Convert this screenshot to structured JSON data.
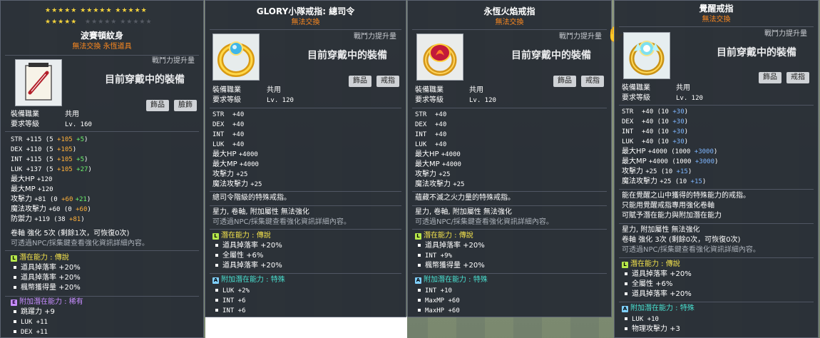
{
  "panel1": {
    "stars_row1": "★★★★★ ★★★★★ ★★★★★",
    "stars_row2_gold": "★★★★★",
    "stars_row2_gray": "★★★★★ ★★★★★",
    "title": "波賽頓紋身",
    "subtitle": "無法交換  永恆道具",
    "power_label": "戰鬥力提升量",
    "equipped": "目前穿戴中的裝備",
    "tags": [
      "飾品",
      "臉飾"
    ],
    "job_label": "裝備職業",
    "job_value": "共用",
    "level_label": "要求等級",
    "level_value": "Lv. 160",
    "stats": [
      {
        "label": "STR",
        "base": "+115 (5 ",
        "add1": "+105",
        "add2": "+5",
        "close": ")"
      },
      {
        "label": "DEX",
        "base": "+110 (5 ",
        "add1": "+105",
        "add2": "",
        "close": ")"
      },
      {
        "label": "INT",
        "base": "+115 (5 ",
        "add1": "+105",
        "add2": "+5",
        "close": ")"
      },
      {
        "label": "LUK",
        "base": "+137 (5 ",
        "add1": "+105",
        "add2": "+27",
        "close": ")"
      },
      {
        "label": "最大HP",
        "base": "+120",
        "add1": "",
        "add2": "",
        "close": ""
      },
      {
        "label": "最大MP",
        "base": "+120",
        "add1": "",
        "add2": "",
        "close": ""
      },
      {
        "label": "攻擊力",
        "base": "+81 (0 ",
        "add1": "+60",
        "add2": "+21",
        "close": ")"
      },
      {
        "label": "魔法攻擊力",
        "base": "+60 (0 ",
        "add1": "+60",
        "add2": "",
        "close": ")"
      },
      {
        "label": "防禦力",
        "base": "+119 (38 ",
        "add1": "+81",
        "add2": "",
        "close": ")"
      }
    ],
    "scroll_line": "卷軸 強化 5次 (剩餘1次，可恢復0次)",
    "npc_line": "可透過NPC/採集鍵查看強化資訊詳細內容。",
    "potential_label": "潛在能力 : 傳說",
    "potential": [
      "道具掉落率 +20%",
      "道具掉落率 +20%",
      "楓幣獲得量 +20%"
    ],
    "add_potential_label": "附加潛在能力 : 稀有",
    "add_potential": [
      "跳躍力 +9",
      "LUK +11",
      "DEX +11"
    ]
  },
  "panel2": {
    "title": "GLORY小隊戒指: 總司令",
    "subtitle": "無法交換",
    "power_label": "戰鬥力提升量",
    "equipped": "目前穿戴中的裝備",
    "tags": [
      "飾品",
      "戒指"
    ],
    "job_label": "裝備職業",
    "job_value": "共用",
    "level_label": "要求等級",
    "level_value": "Lv. 120",
    "stats": [
      {
        "label": "STR",
        "value": "+40"
      },
      {
        "label": "DEX",
        "value": "+40"
      },
      {
        "label": "INT",
        "value": "+40"
      },
      {
        "label": "LUK",
        "value": "+40"
      },
      {
        "label": "最大HP",
        "value": "+4000"
      },
      {
        "label": "最大MP",
        "value": "+4000"
      },
      {
        "label": "攻擊力",
        "value": "+25"
      },
      {
        "label": "魔法攻擊力",
        "value": "+25"
      }
    ],
    "desc": "總司令階級的特殊戒指。",
    "flags": "星力, 卷軸, 附加屬性 無法強化",
    "npc_line": "可透過NPC/採集鍵查看強化資訊詳細內容。",
    "potential_label": "潛在能力 : 傳說",
    "potential": [
      "道具掉落率 +20%",
      "全屬性 +6%",
      "道具掉落率 +20%"
    ],
    "add_potential_label": "附加潛在能力 : 特殊",
    "add_potential": [
      "LUK +2%",
      "INT +6",
      "INT +6"
    ]
  },
  "panel3": {
    "title": "永恆火焰戒指",
    "subtitle": "無法交換",
    "power_label": "戰鬥力提升量",
    "equipped": "目前穿戴中的裝備",
    "tags": [
      "飾品",
      "戒指"
    ],
    "job_label": "裝備職業",
    "job_value": "共用",
    "level_label": "要求等級",
    "level_value": "Lv. 120",
    "stats": [
      {
        "label": "STR",
        "value": "+40"
      },
      {
        "label": "DEX",
        "value": "+40"
      },
      {
        "label": "INT",
        "value": "+40"
      },
      {
        "label": "LUK",
        "value": "+40"
      },
      {
        "label": "最大HP",
        "value": "+4000"
      },
      {
        "label": "最大MP",
        "value": "+4000"
      },
      {
        "label": "攻擊力",
        "value": "+25"
      },
      {
        "label": "魔法攻擊力",
        "value": "+25"
      }
    ],
    "desc": "蘊藏不滅之火力量的特殊戒指。",
    "flags": "星力, 卷軸, 附加屬性 無法強化",
    "npc_line": "可透過NPC/採集鍵查看強化資訊詳細內容。",
    "potential_label": "潛在能力 : 傳說",
    "potential": [
      "道具掉落率 +20%",
      "INT +9%",
      "楓幣獲得量 +20%"
    ],
    "add_potential_label": "附加潛在能力 : 特殊",
    "add_potential": [
      "INT +10",
      "MaxMP +60",
      "MaxHP +60"
    ]
  },
  "panel4": {
    "title": "覺醒戒指",
    "subtitle": "無法交換",
    "power_label": "戰鬥力提升量",
    "equipped": "目前穿戴中的裝備",
    "tags": [
      "飾品",
      "戒指"
    ],
    "job_label": "裝備職業",
    "job_value": "共用",
    "level_label": "要求等級",
    "level_value": "Lv. 120",
    "stats": [
      {
        "label": "STR",
        "base": "+40 (10 ",
        "add": "+30",
        "close": ")"
      },
      {
        "label": "DEX",
        "base": "+40 (10 ",
        "add": "+30",
        "close": ")"
      },
      {
        "label": "INT",
        "base": "+40 (10 ",
        "add": "+30",
        "close": ")"
      },
      {
        "label": "LUK",
        "base": "+40 (10 ",
        "add": "+30",
        "close": ")"
      },
      {
        "label": "最大HP",
        "base": "+4000 (1000 ",
        "add": "+3000",
        "close": ")"
      },
      {
        "label": "最大MP",
        "base": "+4000 (1000 ",
        "add": "+3000",
        "close": ")"
      },
      {
        "label": "攻擊力",
        "base": "+25 (10 ",
        "add": "+15",
        "close": ")"
      },
      {
        "label": "魔法攻擊力",
        "base": "+25 (10 ",
        "add": "+15",
        "close": ")"
      }
    ],
    "desc": [
      "能在覺醒之山中獲得的特殊能力的戒指。",
      "只能用覺醒戒指專用強化卷軸",
      "可賦予潛在能力與附加潛在能力"
    ],
    "flags": "星力, 附加屬性 無法強化",
    "scroll_line": "卷軸 強化 3次 (剩餘0次，可恢復0次)",
    "npc_line": "可透過NPC/採集鍵查看強化資訊詳細內容。",
    "potential_label": "潛在能力 : 傳說",
    "potential": [
      "道具掉落率 +20%",
      "全屬性 +6%",
      "道具掉落率 +20%"
    ],
    "add_potential_label": "附加潛在能力 : 特殊",
    "add_potential": [
      "LUK +10",
      "物理攻擊力 +3"
    ]
  }
}
